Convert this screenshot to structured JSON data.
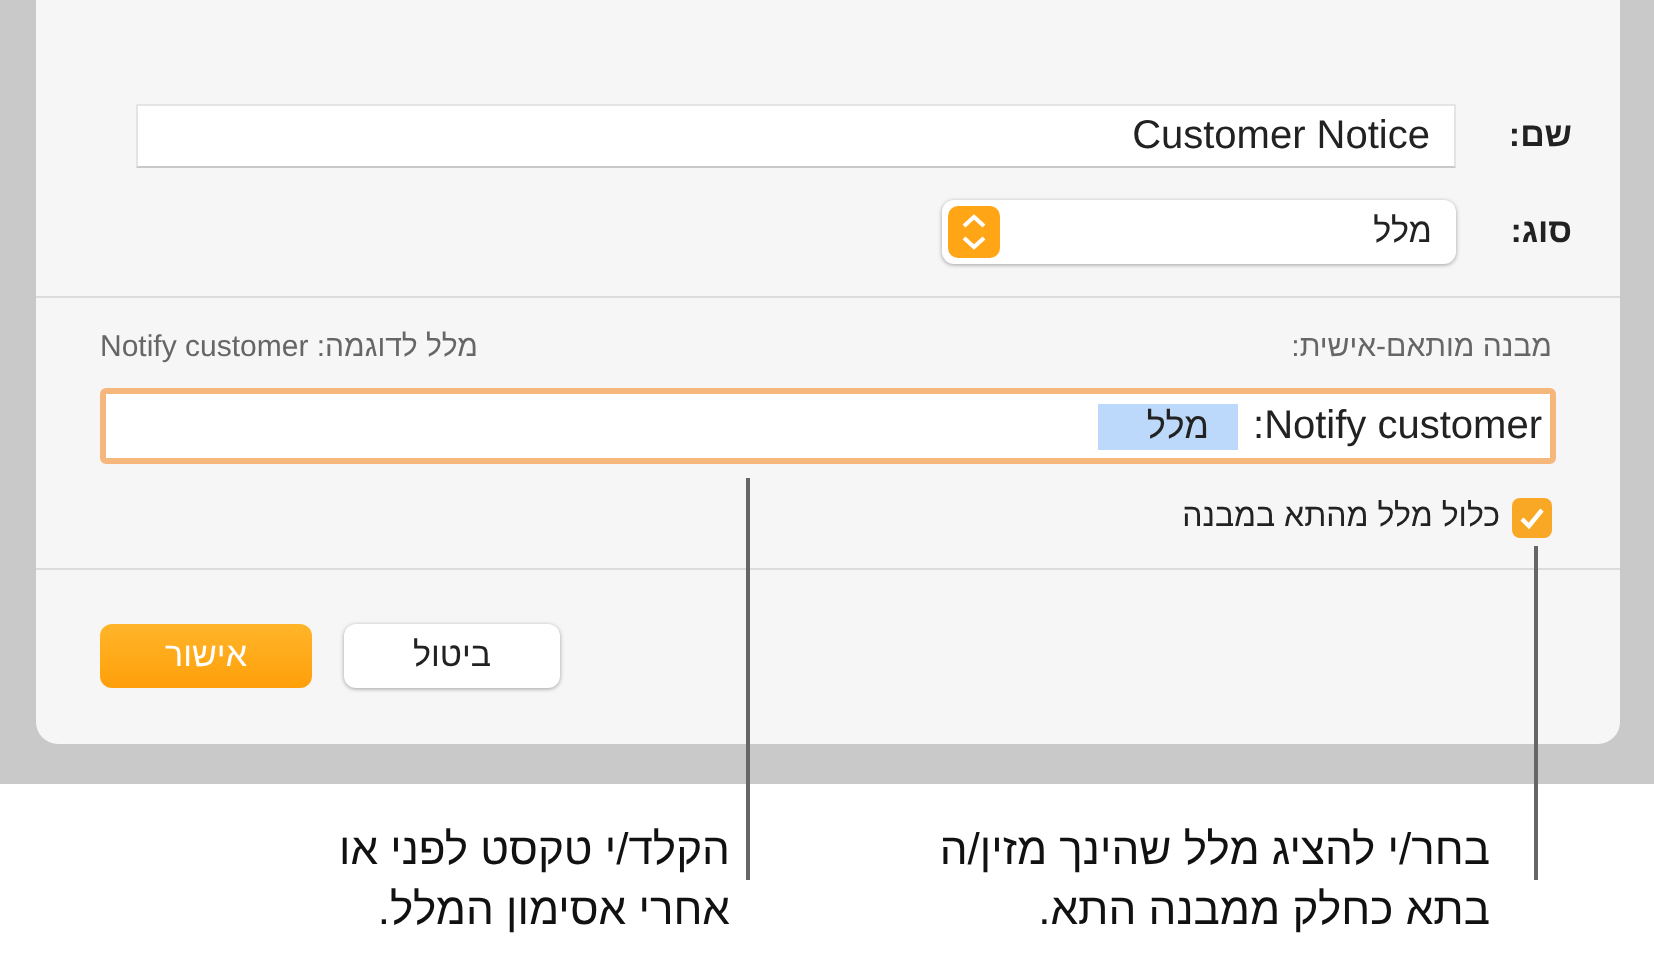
{
  "dialog": {
    "name_label": "שם:",
    "name_value": "Customer Notice",
    "type_label": "סוג:",
    "type_value": "מלל",
    "format_label": "מבנה מותאם-אישית:",
    "example": "מלל לדוגמה: Notify customer",
    "format_field": {
      "focused": true,
      "prefix": "Notify customer:",
      "token": "מלל"
    },
    "include_checkbox": {
      "label": "כלול מלל מהתא במבנה",
      "checked": true
    },
    "buttons": [
      {
        "label": "ביטול",
        "kind": "secondary"
      },
      {
        "label": "אישור",
        "kind": "primary"
      }
    ]
  },
  "callouts": [
    {
      "lines": [
        "בחר/י להציג מלל שהינך מזין/ה",
        "בתא כחלק ממבנה התא."
      ]
    },
    {
      "lines": [
        "הקלד/י טקסט לפני או",
        "אחרי אסימון המלל."
      ]
    }
  ]
}
